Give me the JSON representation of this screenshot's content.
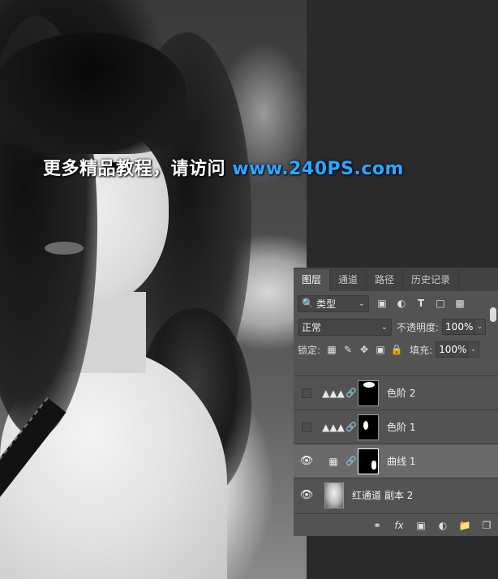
{
  "watermark": {
    "cn": "更多精品教程，请访问",
    "url": "www.240PS.com"
  },
  "panel": {
    "tabs": [
      "图层",
      "通道",
      "路径",
      "历史记录"
    ],
    "filter": {
      "label": "类型"
    },
    "blend_mode": "正常",
    "opacity_label": "不透明度:",
    "opacity_value": "100%",
    "lock_label": "锁定:",
    "fill_label": "填充:",
    "fill_value": "100%",
    "layers": [
      {
        "name": "色阶 2",
        "visible": false,
        "type": "levels-adjustment"
      },
      {
        "name": "色阶 1",
        "visible": false,
        "type": "levels-adjustment"
      },
      {
        "name": "曲线 1",
        "visible": true,
        "type": "curves-adjustment",
        "selected": true
      },
      {
        "name": "红通道 副本 2",
        "visible": true,
        "type": "pixel-layer"
      }
    ],
    "footer_icons": [
      "link-icon",
      "fx-icon",
      "mask-icon",
      "adjustment-icon",
      "folder-icon",
      "new-layer-icon"
    ]
  }
}
